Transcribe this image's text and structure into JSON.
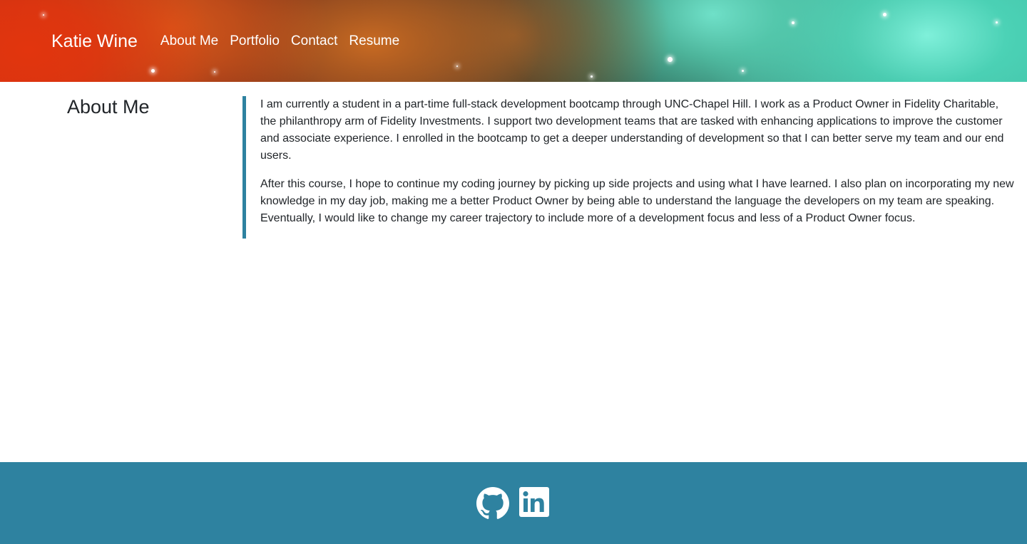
{
  "header": {
    "brand": "Katie Wine",
    "nav": [
      {
        "label": "About Me"
      },
      {
        "label": "Portfolio"
      },
      {
        "label": "Contact"
      },
      {
        "label": "Resume"
      }
    ]
  },
  "about": {
    "title": "About Me",
    "paragraphs": [
      "I am currently a student in a part-time full-stack development bootcamp through UNC-Chapel Hill. I work as a Product Owner in Fidelity Charitable, the philanthropy arm of Fidelity Investments. I support two development teams that are tasked with enhancing applications to improve the customer and associate experience. I enrolled in the bootcamp to get a deeper understanding of development so that I can better serve my team and our end users.",
      "After this course, I hope to continue my coding journey by picking up side projects and using what I have learned. I also plan on incorporating my new knowledge in my day job, making me a better Product Owner by being able to understand the language the developers on my team are speaking. Eventually, I would like to change my career trajectory to include more of a development focus and less of a Product Owner focus."
    ]
  },
  "footer": {
    "icons": [
      "github-icon",
      "linkedin-icon"
    ]
  },
  "colors": {
    "accent": "#2e82a0",
    "text": "#212529",
    "nav_text": "#ffffff"
  }
}
